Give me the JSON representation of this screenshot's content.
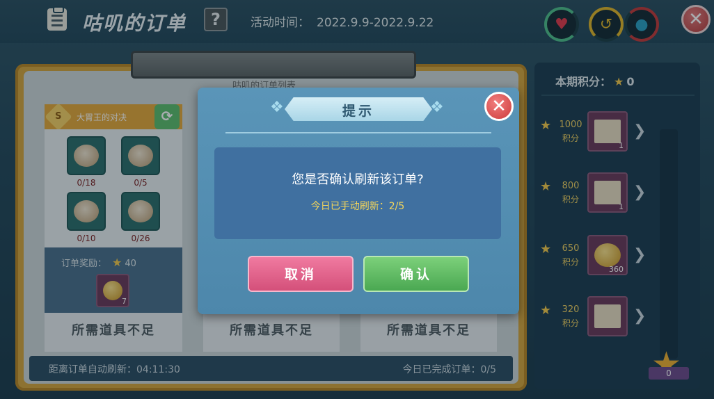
{
  "header": {
    "title": "咕叽的订单",
    "help": "?",
    "event_label": "活动时间：",
    "event_range": "2022.9.9-2022.9.22",
    "close": "✕"
  },
  "board": {
    "list_title": "咕叽的订单列表",
    "order": {
      "title": "大胃王的对决",
      "badge": "S",
      "refresh": "⟳",
      "foods": [
        {
          "count": "0/18"
        },
        {
          "count": "0/5"
        },
        {
          "count": "0/10"
        },
        {
          "count": "0/26"
        }
      ],
      "reward_label": "订单奖励：",
      "reward_points": "40",
      "reward_qty": "7"
    },
    "insufficient": [
      "所需道具不足",
      "所需道具不足",
      "所需道具不足"
    ],
    "footer_left_label": "距离订单自动刷新：",
    "footer_left_value": "04:11:30",
    "footer_right_label": "今日已完成订单：",
    "footer_right_value": "0/5"
  },
  "points_panel": {
    "label": "本期积分：",
    "value": "0",
    "unit": "积分",
    "tiers": [
      {
        "score": "1000",
        "qty": "1"
      },
      {
        "score": "800",
        "qty": "1"
      },
      {
        "score": "650",
        "qty": "360"
      },
      {
        "score": "320",
        "qty": ""
      }
    ],
    "badge_value": "0"
  },
  "dialog": {
    "title": "提示",
    "message": "您是否确认刷新该订单?",
    "sub_label": "今日已手动刷新：",
    "sub_value": "2/5",
    "cancel": "取消",
    "confirm": "确认",
    "close": "✕"
  },
  "colors": {
    "accent_gold": "#f5c94a",
    "confirm_green": "#4aa852",
    "cancel_pink": "#d4507a",
    "close_red": "#cc3a3a"
  }
}
